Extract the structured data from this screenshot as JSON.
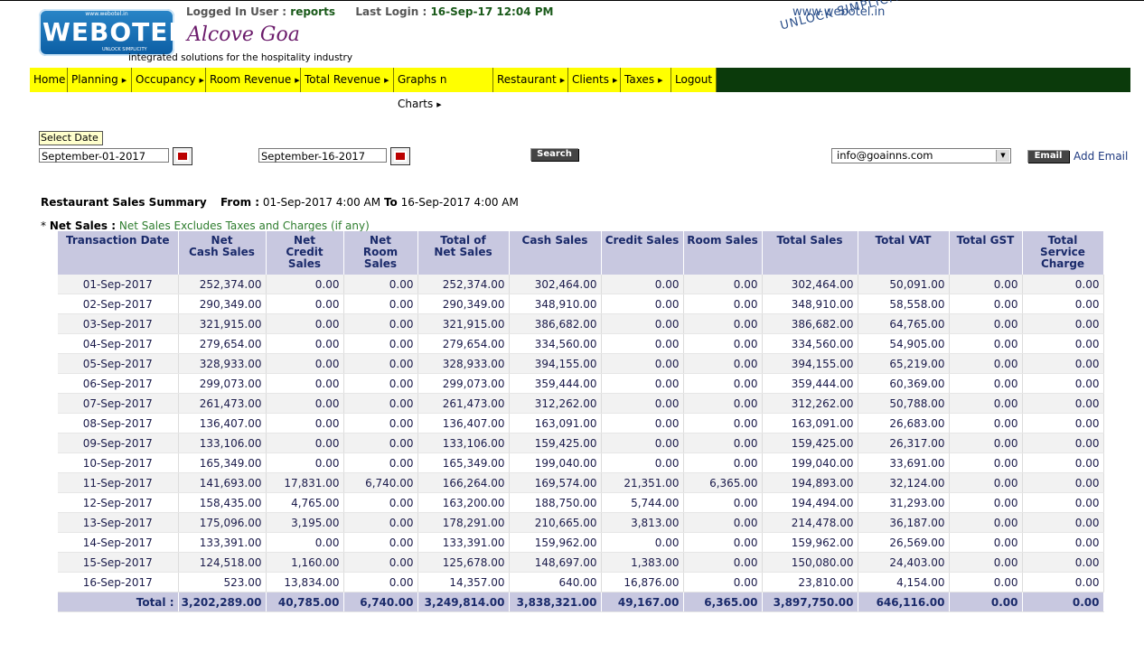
{
  "header": {
    "logo_url_text": "www.webotel.in",
    "logo_word": "WEBOTEL",
    "logo_tag": "UNLOCK SIMPLICITY",
    "logged_in_label": "Logged In User :",
    "logged_in_user": "reports",
    "last_login_label": "Last Login :",
    "last_login_value": "16-Sep-17 12:04 PM",
    "hotel_name": "Alcove Goa",
    "tagline": "integrated solutions for the hospitality industry",
    "site_url": "www.webotel.in",
    "slogan": "UNLOCK SIMPLICITY"
  },
  "nav": [
    {
      "label": "Home",
      "has_sub": false
    },
    {
      "label": "Planning",
      "has_sub": true
    },
    {
      "label": "Occupancy",
      "has_sub": true
    },
    {
      "label": "Room Revenue",
      "has_sub": true
    },
    {
      "label": "Total Revenue",
      "has_sub": true
    },
    {
      "label": "Graphs n Charts",
      "has_sub": true
    },
    {
      "label": "Restaurant",
      "has_sub": true
    },
    {
      "label": "Clients",
      "has_sub": true
    },
    {
      "label": "Taxes",
      "has_sub": true
    },
    {
      "label": "Logout",
      "has_sub": false
    }
  ],
  "filters": {
    "select_date_label": "Select Date",
    "from_date": "September-01-2017",
    "to_date": "September-16-2017",
    "search_label": "Search",
    "email_value": "info@goainns.com",
    "email_button": "Email",
    "add_email": "Add Email"
  },
  "summary": {
    "title": "Restaurant Sales Summary",
    "from_label": "From :",
    "from_value": "01-Sep-2017 4:00 AM",
    "to_label": "To",
    "to_value": "16-Sep-2017 4:00 AM",
    "note_star": "*",
    "note_label": "Net Sales :",
    "note_text": "Net Sales Excludes Taxes and Charges (if any)"
  },
  "table": {
    "headers": [
      "Transaction Date",
      "Net\nCash Sales",
      "Net\nCredit\nSales",
      "Net\nRoom\nSales",
      "Total of\nNet Sales",
      "Cash Sales",
      "Credit Sales",
      "Room Sales",
      "Total Sales",
      "Total VAT",
      "Total GST",
      "Total\nService\nCharge"
    ],
    "rows": [
      [
        "01-Sep-2017",
        "252,374.00",
        "0.00",
        "0.00",
        "252,374.00",
        "302,464.00",
        "0.00",
        "0.00",
        "302,464.00",
        "50,091.00",
        "0.00",
        "0.00"
      ],
      [
        "02-Sep-2017",
        "290,349.00",
        "0.00",
        "0.00",
        "290,349.00",
        "348,910.00",
        "0.00",
        "0.00",
        "348,910.00",
        "58,558.00",
        "0.00",
        "0.00"
      ],
      [
        "03-Sep-2017",
        "321,915.00",
        "0.00",
        "0.00",
        "321,915.00",
        "386,682.00",
        "0.00",
        "0.00",
        "386,682.00",
        "64,765.00",
        "0.00",
        "0.00"
      ],
      [
        "04-Sep-2017",
        "279,654.00",
        "0.00",
        "0.00",
        "279,654.00",
        "334,560.00",
        "0.00",
        "0.00",
        "334,560.00",
        "54,905.00",
        "0.00",
        "0.00"
      ],
      [
        "05-Sep-2017",
        "328,933.00",
        "0.00",
        "0.00",
        "328,933.00",
        "394,155.00",
        "0.00",
        "0.00",
        "394,155.00",
        "65,219.00",
        "0.00",
        "0.00"
      ],
      [
        "06-Sep-2017",
        "299,073.00",
        "0.00",
        "0.00",
        "299,073.00",
        "359,444.00",
        "0.00",
        "0.00",
        "359,444.00",
        "60,369.00",
        "0.00",
        "0.00"
      ],
      [
        "07-Sep-2017",
        "261,473.00",
        "0.00",
        "0.00",
        "261,473.00",
        "312,262.00",
        "0.00",
        "0.00",
        "312,262.00",
        "50,788.00",
        "0.00",
        "0.00"
      ],
      [
        "08-Sep-2017",
        "136,407.00",
        "0.00",
        "0.00",
        "136,407.00",
        "163,091.00",
        "0.00",
        "0.00",
        "163,091.00",
        "26,683.00",
        "0.00",
        "0.00"
      ],
      [
        "09-Sep-2017",
        "133,106.00",
        "0.00",
        "0.00",
        "133,106.00",
        "159,425.00",
        "0.00",
        "0.00",
        "159,425.00",
        "26,317.00",
        "0.00",
        "0.00"
      ],
      [
        "10-Sep-2017",
        "165,349.00",
        "0.00",
        "0.00",
        "165,349.00",
        "199,040.00",
        "0.00",
        "0.00",
        "199,040.00",
        "33,691.00",
        "0.00",
        "0.00"
      ],
      [
        "11-Sep-2017",
        "141,693.00",
        "17,831.00",
        "6,740.00",
        "166,264.00",
        "169,574.00",
        "21,351.00",
        "6,365.00",
        "194,893.00",
        "32,124.00",
        "0.00",
        "0.00"
      ],
      [
        "12-Sep-2017",
        "158,435.00",
        "4,765.00",
        "0.00",
        "163,200.00",
        "188,750.00",
        "5,744.00",
        "0.00",
        "194,494.00",
        "31,293.00",
        "0.00",
        "0.00"
      ],
      [
        "13-Sep-2017",
        "175,096.00",
        "3,195.00",
        "0.00",
        "178,291.00",
        "210,665.00",
        "3,813.00",
        "0.00",
        "214,478.00",
        "36,187.00",
        "0.00",
        "0.00"
      ],
      [
        "14-Sep-2017",
        "133,391.00",
        "0.00",
        "0.00",
        "133,391.00",
        "159,962.00",
        "0.00",
        "0.00",
        "159,962.00",
        "26,569.00",
        "0.00",
        "0.00"
      ],
      [
        "15-Sep-2017",
        "124,518.00",
        "1,160.00",
        "0.00",
        "125,678.00",
        "148,697.00",
        "1,383.00",
        "0.00",
        "150,080.00",
        "24,403.00",
        "0.00",
        "0.00"
      ],
      [
        "16-Sep-2017",
        "523.00",
        "13,834.00",
        "0.00",
        "14,357.00",
        "640.00",
        "16,876.00",
        "0.00",
        "23,810.00",
        "4,154.00",
        "0.00",
        "0.00"
      ]
    ],
    "totals": [
      "Total :",
      "3,202,289.00",
      "40,785.00",
      "6,740.00",
      "3,249,814.00",
      "3,838,321.00",
      "49,167.00",
      "6,365.00",
      "3,897,750.00",
      "646,116.00",
      "0.00",
      "0.00"
    ]
  },
  "colors": {
    "nav_bg": "#0b3a0b",
    "nav_item": "#ffff00",
    "table_header": "#c8c8e0",
    "hotel_name": "#6b1b6b"
  }
}
